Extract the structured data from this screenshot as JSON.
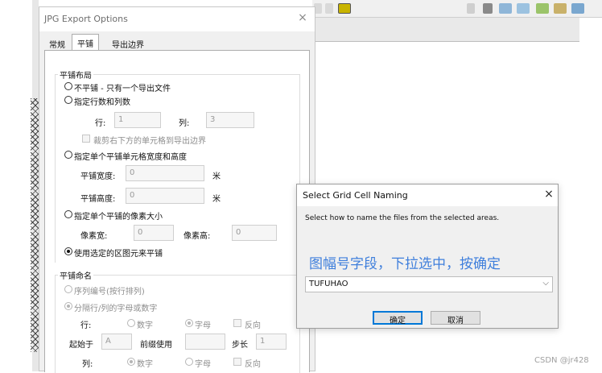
{
  "export_dialog": {
    "title": "JPG Export Options",
    "close_glyph": "×",
    "tabs": [
      "常规",
      "平铺",
      "导出边界"
    ],
    "active_tab": "平铺",
    "tiling_layout": {
      "group_label": "平铺布局",
      "opt_no_tile": "不平铺 - 只有一个导出文件",
      "opt_rows_cols": "指定行数和列数",
      "rows_label": "行:",
      "rows_value": "1",
      "cols_label": "列:",
      "cols_value": "3",
      "clip_label": "裁剪右下方的单元格到导出边界",
      "opt_cell_size": "指定单个平铺单元格宽度和高度",
      "width_label": "平铺宽度:",
      "width_value": "0",
      "width_unit": "米",
      "height_label": "平铺高度:",
      "height_value": "0",
      "height_unit": "米",
      "opt_pixel_size": "指定单个平铺的像素大小",
      "px_width_label": "像素宽:",
      "px_width_value": "0",
      "px_height_label": "像素高:",
      "px_height_value": "0",
      "opt_selected_features": "使用选定的区图元来平铺"
    },
    "tile_naming": {
      "group_label": "平铺命名",
      "opt_sequence": "序列编号(按行排列)",
      "opt_row_col": "分隔行/列的字母或数字",
      "row_label": "行:",
      "digit_label": "数字",
      "letter_label": "字母",
      "reverse_label": "反向",
      "start_label": "起始于",
      "start_value": "A",
      "prefix_label": "前缀使用",
      "prefix_value": "",
      "step_label": "步长",
      "step_value": "1",
      "col_label": "列:",
      "col_digit_label": "数字",
      "col_letter_label": "字母",
      "col_reverse_label": "反向"
    }
  },
  "naming_dialog": {
    "title": "Select Grid Cell Naming",
    "close_glyph": "×",
    "instruction": "Select how to name the files from the selected areas.",
    "annotation": "图幅号字段，下拉选中，按确定",
    "field_value": "TUFUHAO",
    "dropdown_arrow": "⌵",
    "ok_label": "确定",
    "cancel_label": "取消"
  },
  "watermark": "CSDN @jr428",
  "colors": {
    "annotation": "#3f7fdc",
    "default_button_border": "#0078d7"
  }
}
